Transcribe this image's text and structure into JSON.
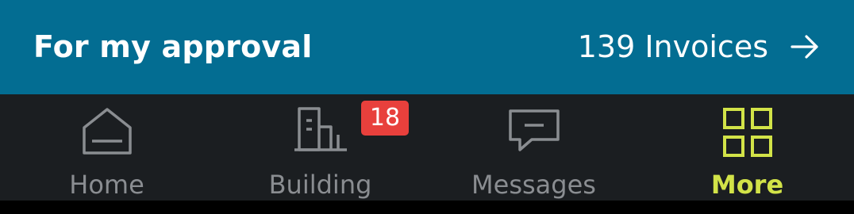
{
  "approval": {
    "title": "For my approval",
    "count_label": "139 Invoices",
    "arrow_icon": "arrow-right-icon"
  },
  "tabbar": {
    "tabs": [
      {
        "label": "Home",
        "icon": "home-icon",
        "active": false
      },
      {
        "label": "Building",
        "icon": "building-icon",
        "active": false
      },
      {
        "label": "Messages",
        "icon": "message-icon",
        "active": false,
        "badge": "18"
      },
      {
        "label": "More",
        "icon": "grid-icon",
        "active": true
      }
    ]
  },
  "colors": {
    "header_bg": "#036d92",
    "tabbar_bg": "#1b1e21",
    "inactive": "#8a8d91",
    "active": "#d2e348",
    "badge": "#e8403c"
  }
}
